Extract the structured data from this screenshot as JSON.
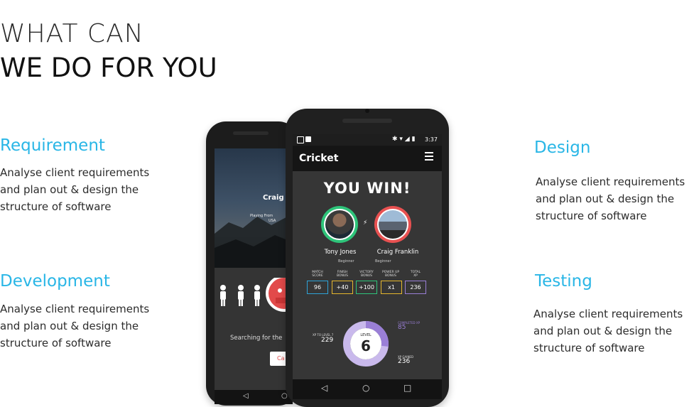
{
  "hero": {
    "line1": "WHAT CAN",
    "line2": "WE DO FOR YOU"
  },
  "features": {
    "requirement": {
      "title": "Requirement",
      "desc": "Analyse client requirements and plan out & design the structure of software"
    },
    "development": {
      "title": "Development",
      "desc": "Analyse client requirements and plan out & design the structure of software"
    },
    "design": {
      "title": "Design",
      "desc": "Analyse client requirements and plan out & design the structure of software"
    },
    "testing": {
      "title": "Testing",
      "desc": "Analyse client requirements and plan out & design the structure of software"
    }
  },
  "back_phone": {
    "player": "Craig",
    "playing_from": "Playing From",
    "country": "USA",
    "searching": "Searching for the",
    "button": "Ca"
  },
  "front_phone": {
    "time": "3:37",
    "app_title": "Cricket",
    "banner": "YOU WIN!",
    "player1": {
      "name": "Tony Jones",
      "rank": "Beginner"
    },
    "player2": {
      "name": "Craig Franklin",
      "rank": "Beginner"
    },
    "stats": [
      {
        "label1": "MATCH",
        "label2": "SCORE",
        "value": "96",
        "color": "#2ea3d8"
      },
      {
        "label1": "FINISH",
        "label2": "BONUS",
        "value": "+40",
        "color": "#e6b72d"
      },
      {
        "label1": "VICTORY",
        "label2": "BONUS",
        "value": "+100",
        "color": "#2ec47a"
      },
      {
        "label1": "POWER UP",
        "label2": "BONUS",
        "value": "x1",
        "color": "#e6b72d"
      },
      {
        "label1": "TOTAL",
        "label2": "XP",
        "value": "236",
        "color": "#9a7fd6"
      }
    ],
    "level_label": "LEVEL",
    "level": "6",
    "xp_to_level_label": "XP TO LEVEL 7",
    "xp_to_level": "229",
    "completed_xp_label": "COMPLETED XP",
    "completed_xp": "85",
    "xp_gained_label": "XP GAINED",
    "xp_gained": "236",
    "level_progress": 0.27
  },
  "colors": {
    "accent": "#29b6e6",
    "win_green": "#2ec47a",
    "win_red": "#e85151",
    "xp_purple": "#9a7fd6"
  }
}
